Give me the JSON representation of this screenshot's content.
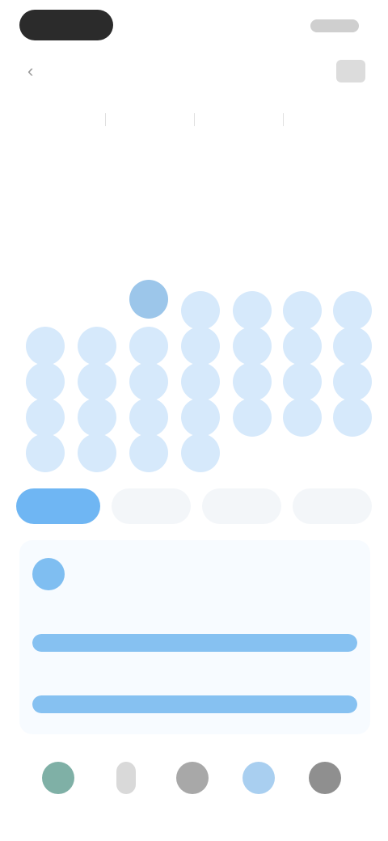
{
  "status_bar": {},
  "header": {
    "back_icon": "chevron-left-icon",
    "title": "",
    "action_icon": "calendar-icon"
  },
  "tabs": [
    {
      "label": ""
    },
    {
      "label": ""
    },
    {
      "label": ""
    },
    {
      "label": ""
    }
  ],
  "sub_title": "",
  "section": {
    "title": "",
    "link": ""
  },
  "calendar": {
    "selected_index": 2,
    "days": [
      "",
      "",
      "",
      "",
      "",
      "",
      "",
      "",
      "",
      "",
      "",
      "",
      "",
      "",
      "",
      "",
      "",
      "",
      "",
      "",
      "",
      "",
      "",
      "",
      "",
      "",
      "",
      "",
      "",
      "",
      "",
      ""
    ]
  },
  "chips": [
    {
      "label": "",
      "active": true
    },
    {
      "label": "",
      "active": false
    },
    {
      "label": "",
      "active": false
    },
    {
      "label": "",
      "active": false
    }
  ],
  "card": {
    "icon": "info-icon",
    "text": "",
    "metrics": [
      {
        "label": "",
        "fraction": 1.0
      },
      {
        "label": "",
        "fraction": 1.0
      }
    ]
  },
  "bottom_nav": {
    "active_index": 3,
    "items": [
      {
        "icon": "home-icon",
        "label": ""
      },
      {
        "icon": "person-icon",
        "label": ""
      },
      {
        "icon": "globe-icon",
        "label": ""
      },
      {
        "icon": "calendar-icon",
        "label": ""
      },
      {
        "icon": "profile-icon",
        "label": ""
      }
    ]
  },
  "colors": {
    "accent": "#6fb6f3",
    "day_bg": "#d6e9fb",
    "selected_day": "#9cc6ea"
  }
}
